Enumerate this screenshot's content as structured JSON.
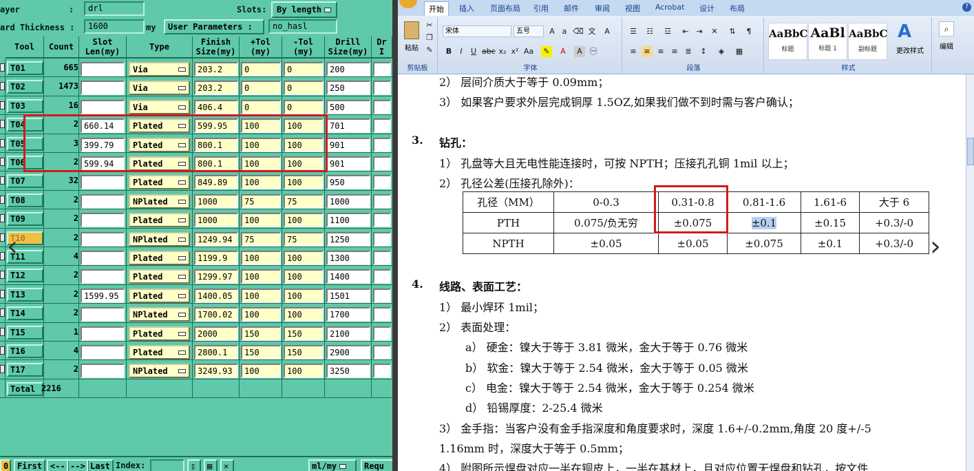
{
  "left": {
    "layer_label": "ayer",
    "layer_colon": ":",
    "layer_value": "drl",
    "slots_label": "Slots:",
    "slots_value": "By length",
    "board_thickness_label": "ard Thickness :",
    "board_thickness_value": "1600",
    "board_thickness_unit": "my",
    "user_params_label": "User Parameters :",
    "user_params_value": "no_hasl",
    "columns": [
      "Tool",
      "Count",
      "Slot\nLen(my)",
      "Type",
      "Finish\nSize(my)",
      "+Tol\n(my)",
      "-Tol\n(my)",
      "Drill\nSize(my)",
      "Dr\nI"
    ],
    "rows": [
      {
        "tool": "T01",
        "count": "665",
        "slot": "",
        "type": "Via",
        "finish": "203.2",
        "ptol": "0",
        "ntol": "0",
        "drill": "200"
      },
      {
        "tool": "T02",
        "count": "1473",
        "slot": "",
        "type": "Via",
        "finish": "203.2",
        "ptol": "0",
        "ntol": "0",
        "drill": "250"
      },
      {
        "tool": "T03",
        "count": "16",
        "slot": "",
        "type": "Via",
        "finish": "406.4",
        "ptol": "0",
        "ntol": "0",
        "drill": "500"
      },
      {
        "tool": "T04",
        "count": "2",
        "slot": "660.14",
        "type": "Plated",
        "finish": "599.95",
        "ptol": "100",
        "ntol": "100",
        "drill": "701"
      },
      {
        "tool": "T05",
        "count": "3",
        "slot": "399.79",
        "type": "Plated",
        "finish": "800.1",
        "ptol": "100",
        "ntol": "100",
        "drill": "901"
      },
      {
        "tool": "T06",
        "count": "2",
        "slot": "599.94",
        "type": "Plated",
        "finish": "800.1",
        "ptol": "100",
        "ntol": "100",
        "drill": "901"
      },
      {
        "tool": "T07",
        "count": "32",
        "slot": "",
        "type": "Plated",
        "finish": "849.89",
        "ptol": "100",
        "ntol": "100",
        "drill": "950"
      },
      {
        "tool": "T08",
        "count": "2",
        "slot": "",
        "type": "NPlated",
        "finish": "1000",
        "ptol": "75",
        "ntol": "75",
        "drill": "1000"
      },
      {
        "tool": "T09",
        "count": "2",
        "slot": "",
        "type": "Plated",
        "finish": "1000",
        "ptol": "100",
        "ntol": "100",
        "drill": "1100"
      },
      {
        "tool": "T10",
        "count": "2",
        "slot": "",
        "type": "NPlated",
        "finish": "1249.94",
        "ptol": "75",
        "ntol": "75",
        "drill": "1250"
      },
      {
        "tool": "T11",
        "count": "4",
        "slot": "",
        "type": "Plated",
        "finish": "1199.9",
        "ptol": "100",
        "ntol": "100",
        "drill": "1300"
      },
      {
        "tool": "T12",
        "count": "2",
        "slot": "",
        "type": "Plated",
        "finish": "1299.97",
        "ptol": "100",
        "ntol": "100",
        "drill": "1400"
      },
      {
        "tool": "T13",
        "count": "2",
        "slot": "1599.95",
        "type": "Plated",
        "finish": "1400.05",
        "ptol": "100",
        "ntol": "100",
        "drill": "1501"
      },
      {
        "tool": "T14",
        "count": "2",
        "slot": "",
        "type": "NPlated",
        "finish": "1700.02",
        "ptol": "100",
        "ntol": "100",
        "drill": "1700"
      },
      {
        "tool": "T15",
        "count": "1",
        "slot": "",
        "type": "Plated",
        "finish": "2000",
        "ptol": "150",
        "ntol": "150",
        "drill": "2100"
      },
      {
        "tool": "T16",
        "count": "4",
        "slot": "",
        "type": "Plated",
        "finish": "2800.1",
        "ptol": "150",
        "ntol": "150",
        "drill": "2900"
      },
      {
        "tool": "T17",
        "count": "2",
        "slot": "",
        "type": "NPlated",
        "finish": "3249.93",
        "ptol": "100",
        "ntol": "100",
        "drill": "3250"
      }
    ],
    "total_label": "Total",
    "total_value": "2216",
    "bottom": {
      "first": "First",
      "prev": "<--",
      "next": "-->",
      "last": "Last",
      "index": "Index:",
      "unit": "ml/my",
      "req": "Requ",
      "zero": "0"
    }
  },
  "word": {
    "tabs": [
      "开始",
      "插入",
      "页面布局",
      "引用",
      "邮件",
      "审阅",
      "视图",
      "Acrobat",
      "设计",
      "布局"
    ],
    "paste": "粘贴",
    "font_name": "宋体",
    "font_size": "五号",
    "group_clipboard": "剪贴板",
    "group_font": "字体",
    "group_paragraph": "段落",
    "group_styles": "样式",
    "styles": [
      {
        "preview": "AaBbC",
        "name": "标题"
      },
      {
        "preview": "AaBl",
        "name": "标题 1"
      },
      {
        "preview": "AaBbC",
        "name": "副标题"
      }
    ],
    "change_styles": "更改样式",
    "edit": "编辑",
    "lines": {
      "l0": "2） 层间介质大于等于 0.09mm；",
      "l1": "3） 如果客户要求外层完成铜厚 1.5OZ,如果我们做不到时需与客户确认；",
      "h3_num": "3.",
      "h3": "钻孔：",
      "l2": "1） 孔盘等大且无电性能连接时，可按 NPTH；压接孔孔铜 1mil 以上；",
      "l3": "2） 孔径公差(压接孔除外)：",
      "h4_num": "4.",
      "h4": "线路、表面工艺：",
      "l4": "1） 最小焊环 1mil；",
      "l5": "2） 表面处理：",
      "l6": "a） 硬金：镍大于等于 3.81 微米，金大于等于 0.76 微米",
      "l7": "b） 软金：镍大于等于 2.54 微米，金大于等于 0.05 微米",
      "l8": "c） 电金：镍大于等于 2.54 微米，金大于等于 0.254 微米",
      "l9": "d） 铅锡厚度：2-25.4 微米",
      "l10": "3） 金手指：当客户没有金手指深度和角度要求时，深度 1.6+/-0.2mm,角度 20 度+/-5",
      "l11": "1.16mm 时，深度大于等于 0.5mm；",
      "l12": "4） 附图所示焊盘对应一半在铜皮上，一半在基材上，且对应位置无焊盘和钻孔，按文件"
    },
    "table": [
      [
        "孔径（MM）",
        "0-0.3",
        "0.31-0.8",
        "0.81-1.6",
        "1.61-6",
        "大于 6"
      ],
      [
        "PTH",
        "0.075/负无穷",
        "±0.075",
        "±0.1",
        "±0.15",
        "+0.3/-0"
      ],
      [
        "NPTH",
        "±0.05",
        "±0.05",
        "±0.075",
        "±0.1",
        "+0.3/-0"
      ]
    ]
  },
  "colors": {
    "highlight_box": "#d11a1a",
    "app_bg": "#5fc9a9"
  }
}
